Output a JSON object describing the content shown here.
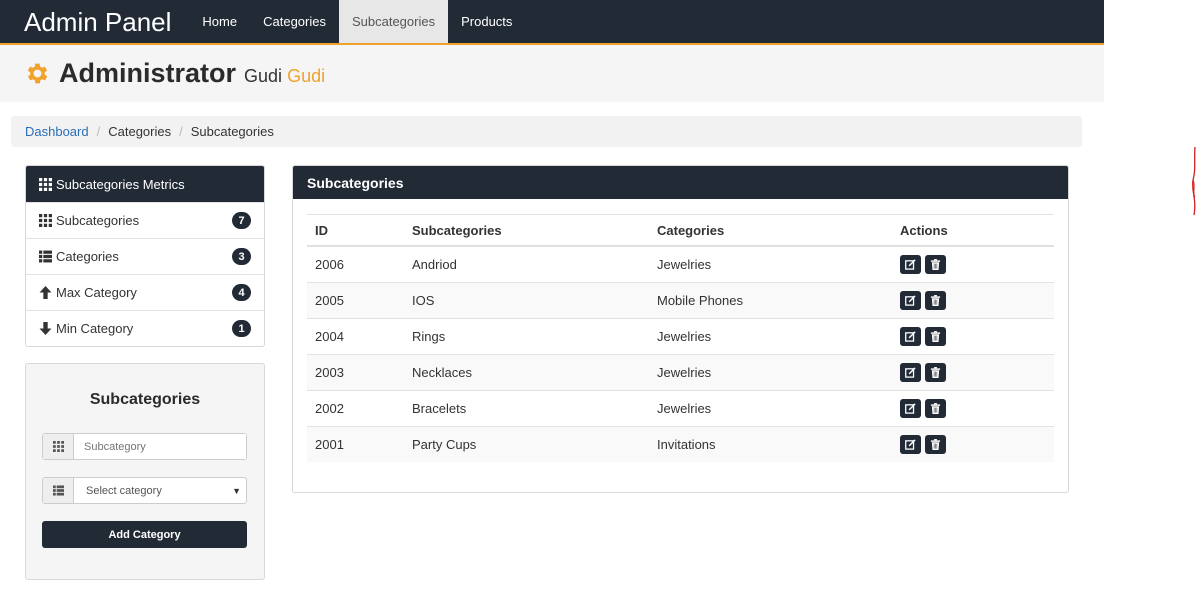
{
  "navbar": {
    "brand": "Admin Panel",
    "links": [
      {
        "label": "Home",
        "active": false
      },
      {
        "label": "Categories",
        "active": false
      },
      {
        "label": "Subcategories",
        "active": true
      },
      {
        "label": "Products",
        "active": false
      }
    ]
  },
  "header": {
    "icon": "gear-icon",
    "title": "Administrator",
    "first_name": "Gudi",
    "last_name": "Gudi"
  },
  "breadcrumb": {
    "items": [
      "Dashboard",
      "Categories",
      "Subcategories"
    ]
  },
  "metrics": {
    "title": "Subcategories Metrics",
    "rows": [
      {
        "icon": "grid-icon",
        "label": "Subcategories",
        "count": "7"
      },
      {
        "icon": "list-icon",
        "label": "Categories",
        "count": "3"
      },
      {
        "icon": "arrow-up-icon",
        "label": "Max Category",
        "count": "4"
      },
      {
        "icon": "arrow-down-icon",
        "label": "Min Category",
        "count": "1"
      }
    ]
  },
  "form": {
    "title": "Subcategories",
    "subcategory_placeholder": "Subcategory",
    "category_select": "Select category",
    "submit_label": "Add Category"
  },
  "table": {
    "title": "Subcategories",
    "columns": [
      "ID",
      "Subcategories",
      "Categories",
      "Actions"
    ],
    "rows": [
      {
        "id": "2006",
        "subcategory": "Andriod",
        "category": "Jewelries"
      },
      {
        "id": "2005",
        "subcategory": "IOS",
        "category": "Mobile Phones"
      },
      {
        "id": "2004",
        "subcategory": "Rings",
        "category": "Jewelries"
      },
      {
        "id": "2003",
        "subcategory": "Necklaces",
        "category": "Jewelries"
      },
      {
        "id": "2002",
        "subcategory": "Bracelets",
        "category": "Jewelries"
      },
      {
        "id": "2001",
        "subcategory": "Party Cups",
        "category": "Invitations"
      }
    ]
  },
  "colors": {
    "dark": "#222a36",
    "accent": "#f0a22d",
    "link": "#2a6eb8"
  }
}
